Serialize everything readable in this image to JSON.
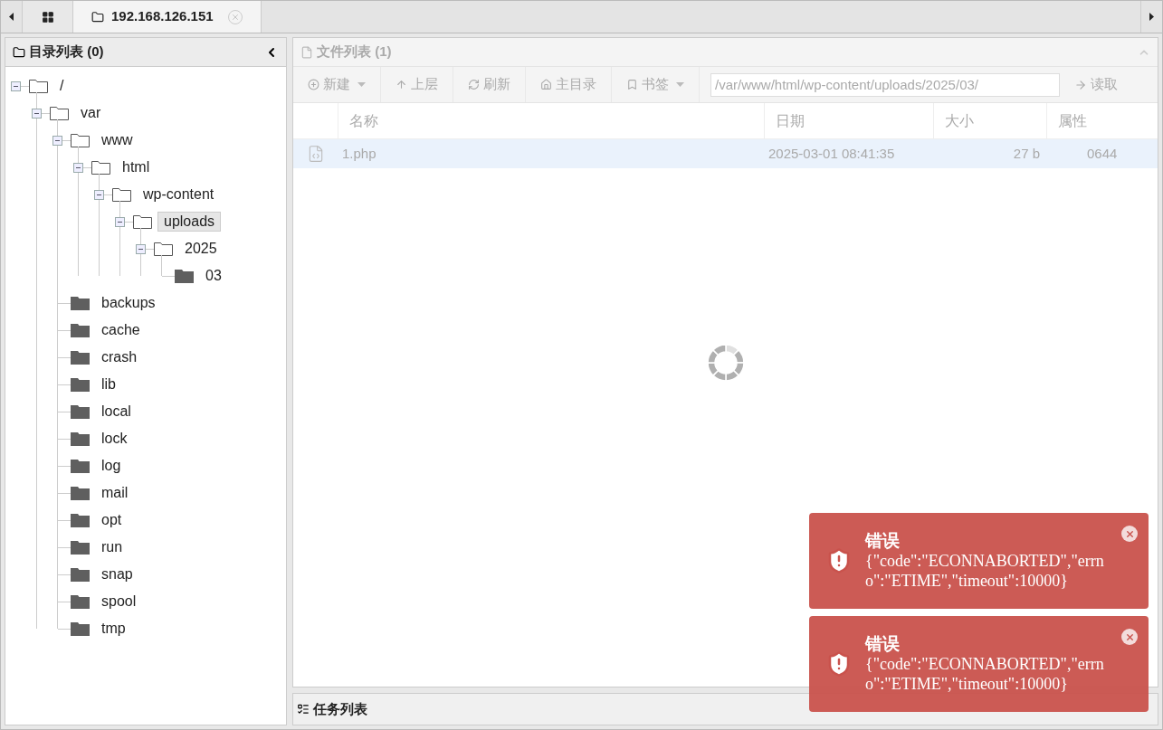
{
  "tabs": [
    {
      "kind": "home",
      "selected": false
    },
    {
      "kind": "host",
      "label": "192.168.126.151",
      "selected": true
    }
  ],
  "directory_panel": {
    "title": "目录列表 (0)",
    "tree": [
      {
        "name": "/",
        "expanded": true,
        "selected": false,
        "children": [
          {
            "name": "var",
            "expanded": true,
            "selected": false,
            "children": [
              {
                "name": "www",
                "expanded": true,
                "selected": false,
                "children": [
                  {
                    "name": "html",
                    "expanded": true,
                    "selected": false,
                    "children": [
                      {
                        "name": "wp-content",
                        "expanded": true,
                        "selected": false,
                        "children": [
                          {
                            "name": "uploads",
                            "expanded": true,
                            "selected": true,
                            "children": [
                              {
                                "name": "2025",
                                "expanded": true,
                                "selected": false,
                                "children": [
                                  {
                                    "name": "03",
                                    "expanded": false,
                                    "selected": false
                                  }
                                ]
                              }
                            ]
                          }
                        ]
                      }
                    ]
                  }
                ]
              },
              {
                "name": "backups",
                "expanded": false,
                "selected": false
              },
              {
                "name": "cache",
                "expanded": false,
                "selected": false
              },
              {
                "name": "crash",
                "expanded": false,
                "selected": false
              },
              {
                "name": "lib",
                "expanded": false,
                "selected": false
              },
              {
                "name": "local",
                "expanded": false,
                "selected": false
              },
              {
                "name": "lock",
                "expanded": false,
                "selected": false
              },
              {
                "name": "log",
                "expanded": false,
                "selected": false
              },
              {
                "name": "mail",
                "expanded": false,
                "selected": false
              },
              {
                "name": "opt",
                "expanded": false,
                "selected": false
              },
              {
                "name": "run",
                "expanded": false,
                "selected": false
              },
              {
                "name": "snap",
                "expanded": false,
                "selected": false
              },
              {
                "name": "spool",
                "expanded": false,
                "selected": false
              },
              {
                "name": "tmp",
                "expanded": false,
                "selected": false
              }
            ]
          }
        ]
      }
    ]
  },
  "file_panel": {
    "title": "文件列表 (1)",
    "loading": true,
    "toolbar": [
      {
        "label": "新建",
        "dropdown": true
      },
      {
        "label": "上层",
        "dropdown": false
      },
      {
        "label": "刷新",
        "dropdown": false
      },
      {
        "label": "主目录",
        "dropdown": false
      },
      {
        "label": "书签",
        "dropdown": true
      }
    ],
    "path": "/var/www/html/wp-content/uploads/2025/03/",
    "read_button": "读取",
    "columns": [
      "名称",
      "日期",
      "大小",
      "属性"
    ],
    "rows": [
      {
        "name": "1.php",
        "date": "2025-03-01 08:41:35",
        "size": "27 b",
        "mode": "0644",
        "selected": true
      }
    ]
  },
  "task_panel": {
    "title": "任务列表"
  },
  "notifications": [
    {
      "title": "错误",
      "message": "{\"code\":\"ECONNABORTED\",\"errno\":\"ETIME\",\"timeout\":10000}"
    },
    {
      "title": "错误",
      "message": "{\"code\":\"ECONNABORTED\",\"errno\":\"ETIME\",\"timeout\":10000}"
    }
  ]
}
